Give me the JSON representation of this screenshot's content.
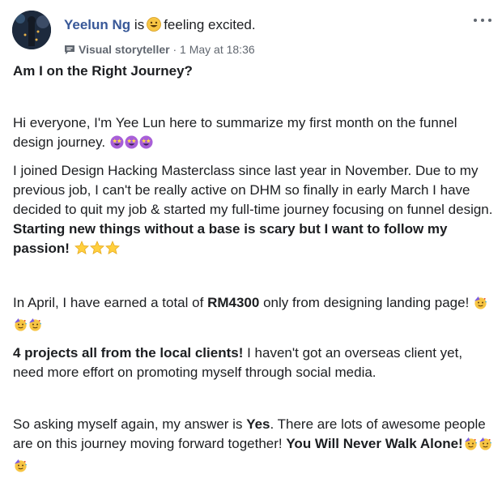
{
  "post": {
    "author": "Yeelun Ng",
    "is_text": "is",
    "feeling": "feeling excited.",
    "badge_label": "Visual storyteller",
    "separator": "·",
    "timestamp": "1 May at 18:36",
    "more_icon": "more-horizontal-icon"
  },
  "body": {
    "title": "Am I on the Right Journey?",
    "p1": "Hi everyone, I'm Yee Lun here to summarize my first month on the funnel design journey.",
    "p2_a": "I joined Design Hacking Masterclass since last year in November. Due to my previous job, I can't be really active on DHM so finally in early March I have decided to quit my job & started my full-time journey focusing on funnel design.",
    "p2_b": "Starting new things without a base is scary but I want to follow my passion!",
    "p3_a": "In April, I have earned a total of",
    "p3_b": "RM4300",
    "p3_c": "only from designing landing page!",
    "p4_a": "4 projects all from the local clients!",
    "p4_b": "I haven't got an overseas client yet, need more effort on promoting myself through social media.",
    "p5_a": "So asking myself again, my answer is",
    "p5_b": "Yes",
    "p5_c": ". There are lots of awesome people are on this journey moving forward together!",
    "p5_d": "You Will Never Walk Alone!"
  },
  "emoji_icons": [
    "star-struck-icon",
    "star-icon",
    "partying-face-icon",
    "grinning-face-icon"
  ],
  "colors": {
    "author": "#385898",
    "meta": "#616770",
    "text": "#1c1e21"
  }
}
